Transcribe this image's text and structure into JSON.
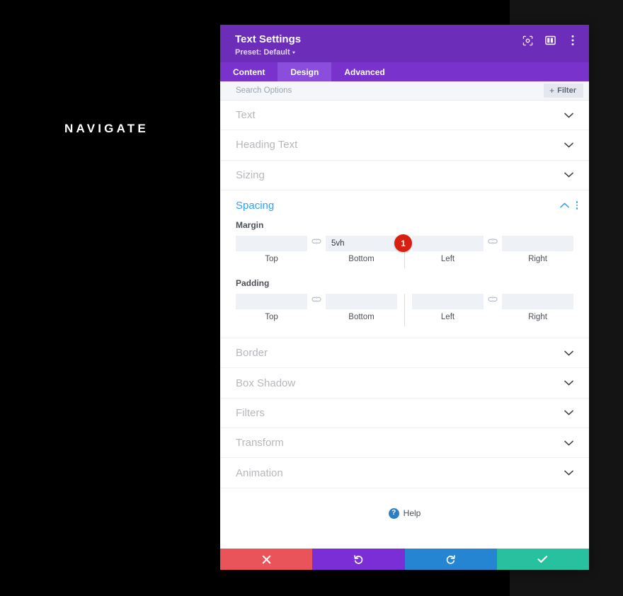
{
  "canvas": {
    "headline": "NAVIGATE",
    "background_color": "#000000",
    "background_right_color": "#141414"
  },
  "modal": {
    "title": "Text Settings",
    "preset_label": "Preset: Default",
    "header_color": "#6c2eb9",
    "tabs_color": "#7933cc",
    "accent_color": "#2ea3f2",
    "header_icons": [
      {
        "name": "focus-icon",
        "label": "Focus"
      },
      {
        "name": "layout-panel-icon",
        "label": "Panel Layout"
      },
      {
        "name": "more-vertical-icon",
        "label": "More Options"
      }
    ],
    "tabs": [
      {
        "label": "Content",
        "active": false
      },
      {
        "label": "Design",
        "active": true
      },
      {
        "label": "Advanced",
        "active": false
      }
    ],
    "search": {
      "placeholder": "Search Options",
      "value": "",
      "filter_label": "Filter",
      "filter_plus": "+"
    },
    "sections": [
      {
        "label": "Text",
        "open": false
      },
      {
        "label": "Heading Text",
        "open": false
      },
      {
        "label": "Sizing",
        "open": false
      }
    ],
    "spacing": {
      "label": "Spacing",
      "open": true,
      "margin": {
        "group_label": "Margin",
        "fields": [
          {
            "label": "Top",
            "value": "",
            "placeholder": ""
          },
          {
            "label": "Bottom",
            "value": "5vh",
            "placeholder": ""
          },
          {
            "label": "Left",
            "value": "",
            "placeholder": ""
          },
          {
            "label": "Right",
            "value": "",
            "placeholder": ""
          }
        ],
        "badge": "1",
        "badge_color": "#d91f11"
      },
      "padding": {
        "group_label": "Padding",
        "fields": [
          {
            "label": "Top",
            "value": "",
            "placeholder": ""
          },
          {
            "label": "Bottom",
            "value": "",
            "placeholder": ""
          },
          {
            "label": "Left",
            "value": "",
            "placeholder": ""
          },
          {
            "label": "Right",
            "value": "",
            "placeholder": ""
          }
        ]
      }
    },
    "sections_after": [
      {
        "label": "Border",
        "open": false
      },
      {
        "label": "Box Shadow",
        "open": false
      },
      {
        "label": "Filters",
        "open": false
      },
      {
        "label": "Transform",
        "open": false
      },
      {
        "label": "Animation",
        "open": false
      }
    ],
    "help": {
      "label": "Help",
      "icon_char": "?",
      "icon_color": "#2c7fc4"
    },
    "footer_actions": [
      {
        "name": "cancel-button",
        "icon": "close-icon",
        "color": "#e8545a"
      },
      {
        "name": "undo-button",
        "icon": "undo-icon",
        "color": "#7b2ed6"
      },
      {
        "name": "redo-button",
        "icon": "redo-icon",
        "color": "#2585d3"
      },
      {
        "name": "save-button",
        "icon": "check-icon",
        "color": "#27c1a0"
      }
    ]
  }
}
